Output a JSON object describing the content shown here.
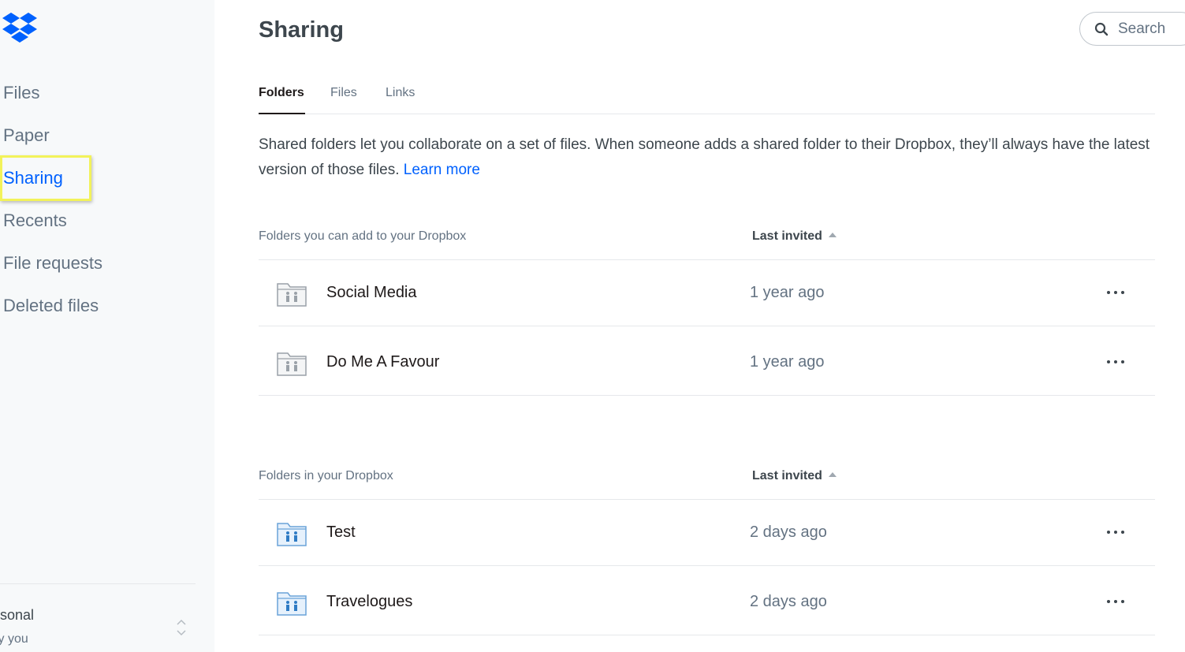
{
  "sidebar": {
    "logo": "dropbox-logo",
    "items": [
      {
        "label": "Files"
      },
      {
        "label": "Paper"
      },
      {
        "label": "Sharing"
      },
      {
        "label": "Recents"
      },
      {
        "label": "File requests"
      },
      {
        "label": "Deleted files"
      }
    ],
    "active_item": "Sharing",
    "account": {
      "name": "rsonal",
      "subtitle": "ly you"
    }
  },
  "header": {
    "title": "Sharing",
    "search": {
      "placeholder": "Search",
      "icon": "search-icon"
    }
  },
  "tabs": [
    {
      "label": "Folders",
      "active": true
    },
    {
      "label": "Files",
      "active": false
    },
    {
      "label": "Links",
      "active": false
    }
  ],
  "description": {
    "text": "Shared folders let you collaborate on a set of files. When someone adds a shared folder to their Dropbox, they’ll always have the latest version of those files. ",
    "link": "Learn more"
  },
  "sections": [
    {
      "title": "Folders you can add to your Dropbox",
      "sort_label": "Last invited",
      "rows": [
        {
          "name": "Social Media",
          "time": "1 year ago",
          "icon": "shared-folder-gray-icon"
        },
        {
          "name": "Do Me A Favour",
          "time": "1 year ago",
          "icon": "shared-folder-gray-icon"
        }
      ]
    },
    {
      "title": "Folders in your Dropbox",
      "sort_label": "Last invited",
      "rows": [
        {
          "name": "Test",
          "time": "2 days ago",
          "icon": "shared-folder-blue-icon"
        },
        {
          "name": "Travelogues",
          "time": "2 days ago",
          "icon": "shared-folder-blue-icon"
        }
      ]
    }
  ],
  "colors": {
    "accent": "#0061fe",
    "highlight": "#f2f25a",
    "sidebar_bg": "#f7f9fa"
  }
}
